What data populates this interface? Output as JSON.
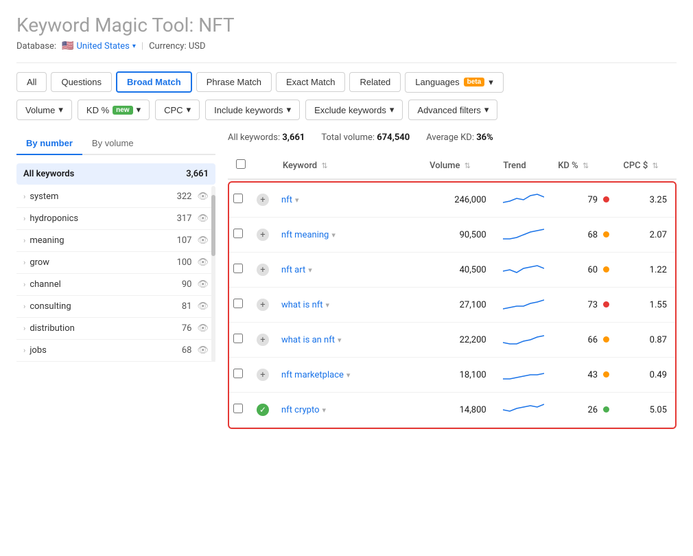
{
  "header": {
    "title": "Keyword Magic Tool: ",
    "keyword": "NFT",
    "database_label": "Database:",
    "database_value": "United States",
    "currency_label": "Currency: USD"
  },
  "tabs": [
    {
      "id": "all",
      "label": "All",
      "active": false
    },
    {
      "id": "questions",
      "label": "Questions",
      "active": false
    },
    {
      "id": "broad-match",
      "label": "Broad Match",
      "active": true
    },
    {
      "id": "phrase-match",
      "label": "Phrase Match",
      "active": false
    },
    {
      "id": "exact-match",
      "label": "Exact Match",
      "active": false
    },
    {
      "id": "related",
      "label": "Related",
      "active": false
    }
  ],
  "languages_label": "Languages",
  "beta_label": "beta",
  "filters": [
    {
      "id": "volume",
      "label": "Volume"
    },
    {
      "id": "kd",
      "label": "KD %",
      "badge": "new"
    },
    {
      "id": "cpc",
      "label": "CPC"
    },
    {
      "id": "include",
      "label": "Include keywords"
    },
    {
      "id": "exclude",
      "label": "Exclude keywords"
    },
    {
      "id": "advanced",
      "label": "Advanced filters"
    }
  ],
  "stats": {
    "all_keywords_label": "All keywords:",
    "all_keywords_value": "3,661",
    "total_volume_label": "Total volume:",
    "total_volume_value": "674,540",
    "avg_kd_label": "Average KD:",
    "avg_kd_value": "36%"
  },
  "view_toggle": [
    {
      "id": "by-number",
      "label": "By number",
      "active": true
    },
    {
      "id": "by-volume",
      "label": "By volume",
      "active": false
    }
  ],
  "sidebar": {
    "header": {
      "label": "All keywords",
      "count": "3,661"
    },
    "items": [
      {
        "label": "system",
        "count": "322"
      },
      {
        "label": "hydroponics",
        "count": "317"
      },
      {
        "label": "meaning",
        "count": "107"
      },
      {
        "label": "grow",
        "count": "100"
      },
      {
        "label": "channel",
        "count": "90"
      },
      {
        "label": "consulting",
        "count": "81"
      },
      {
        "label": "distribution",
        "count": "76"
      },
      {
        "label": "jobs",
        "count": "68"
      }
    ]
  },
  "table": {
    "columns": [
      {
        "id": "keyword",
        "label": "Keyword"
      },
      {
        "id": "volume",
        "label": "Volume"
      },
      {
        "id": "trend",
        "label": "Trend"
      },
      {
        "id": "kd",
        "label": "KD %"
      },
      {
        "id": "cpc",
        "label": "CPC $"
      }
    ],
    "rows": [
      {
        "keyword": "nft",
        "volume": "246,000",
        "kd": 79,
        "kd_color": "red",
        "cpc": "3.25",
        "highlighted": true
      },
      {
        "keyword": "nft meaning",
        "volume": "90,500",
        "kd": 68,
        "kd_color": "orange",
        "cpc": "2.07",
        "highlighted": true
      },
      {
        "keyword": "nft art",
        "volume": "40,500",
        "kd": 60,
        "kd_color": "orange",
        "cpc": "1.22",
        "highlighted": true
      },
      {
        "keyword": "what is nft",
        "volume": "27,100",
        "kd": 73,
        "kd_color": "red",
        "cpc": "1.55",
        "highlighted": true
      },
      {
        "keyword": "what is an nft",
        "volume": "22,200",
        "kd": 66,
        "kd_color": "orange",
        "cpc": "0.87",
        "highlighted": true
      },
      {
        "keyword": "nft marketplace",
        "volume": "18,100",
        "kd": 43,
        "kd_color": "orange",
        "cpc": "0.49",
        "highlighted": true
      },
      {
        "keyword": "nft crypto",
        "volume": "14,800",
        "kd": 26,
        "kd_color": "green",
        "cpc": "5.05",
        "highlighted": true,
        "added": true
      }
    ]
  },
  "icons": {
    "chevron_down": "▾",
    "chevron_right": "›",
    "eye": "👁",
    "plus": "+",
    "check": "✓",
    "sort": "⇅"
  }
}
